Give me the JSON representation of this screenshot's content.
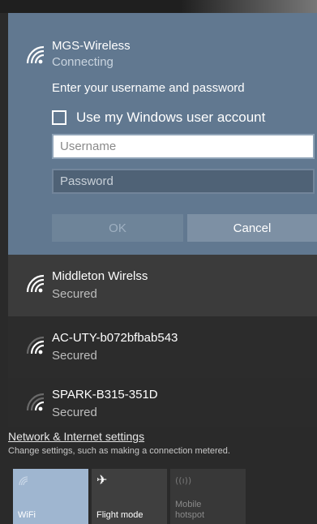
{
  "selected_network": {
    "name": "MGS-Wireless",
    "status": "Connecting",
    "prompt": "Enter your username and password",
    "checkbox_label": "Use my Windows user account",
    "username_placeholder": "Username",
    "password_placeholder": "Password",
    "ok_label": "OK",
    "cancel_label": "Cancel"
  },
  "networks": [
    {
      "name": "Middleton Wirelss",
      "status": "Secured"
    },
    {
      "name": "AC-UTY-b072bfbab543",
      "status": "Secured"
    },
    {
      "name": "SPARK-B315-351D",
      "status": "Secured"
    }
  ],
  "settings": {
    "link": "Network & Internet settings",
    "subtitle": "Change settings, such as making a connection metered."
  },
  "quick_actions": [
    {
      "label": "WiFi",
      "icon": "wifi-icon",
      "state": "on"
    },
    {
      "label": "Flight mode",
      "icon": "airplane-icon",
      "state": "off"
    },
    {
      "label": "Mobile\nhotspot",
      "icon": "hotspot-icon",
      "state": "disabled"
    }
  ],
  "colors": {
    "selected_panel": "#617890",
    "wifi_tile_on": "#9fb6d0",
    "tile_off": "#3f3f3f"
  }
}
